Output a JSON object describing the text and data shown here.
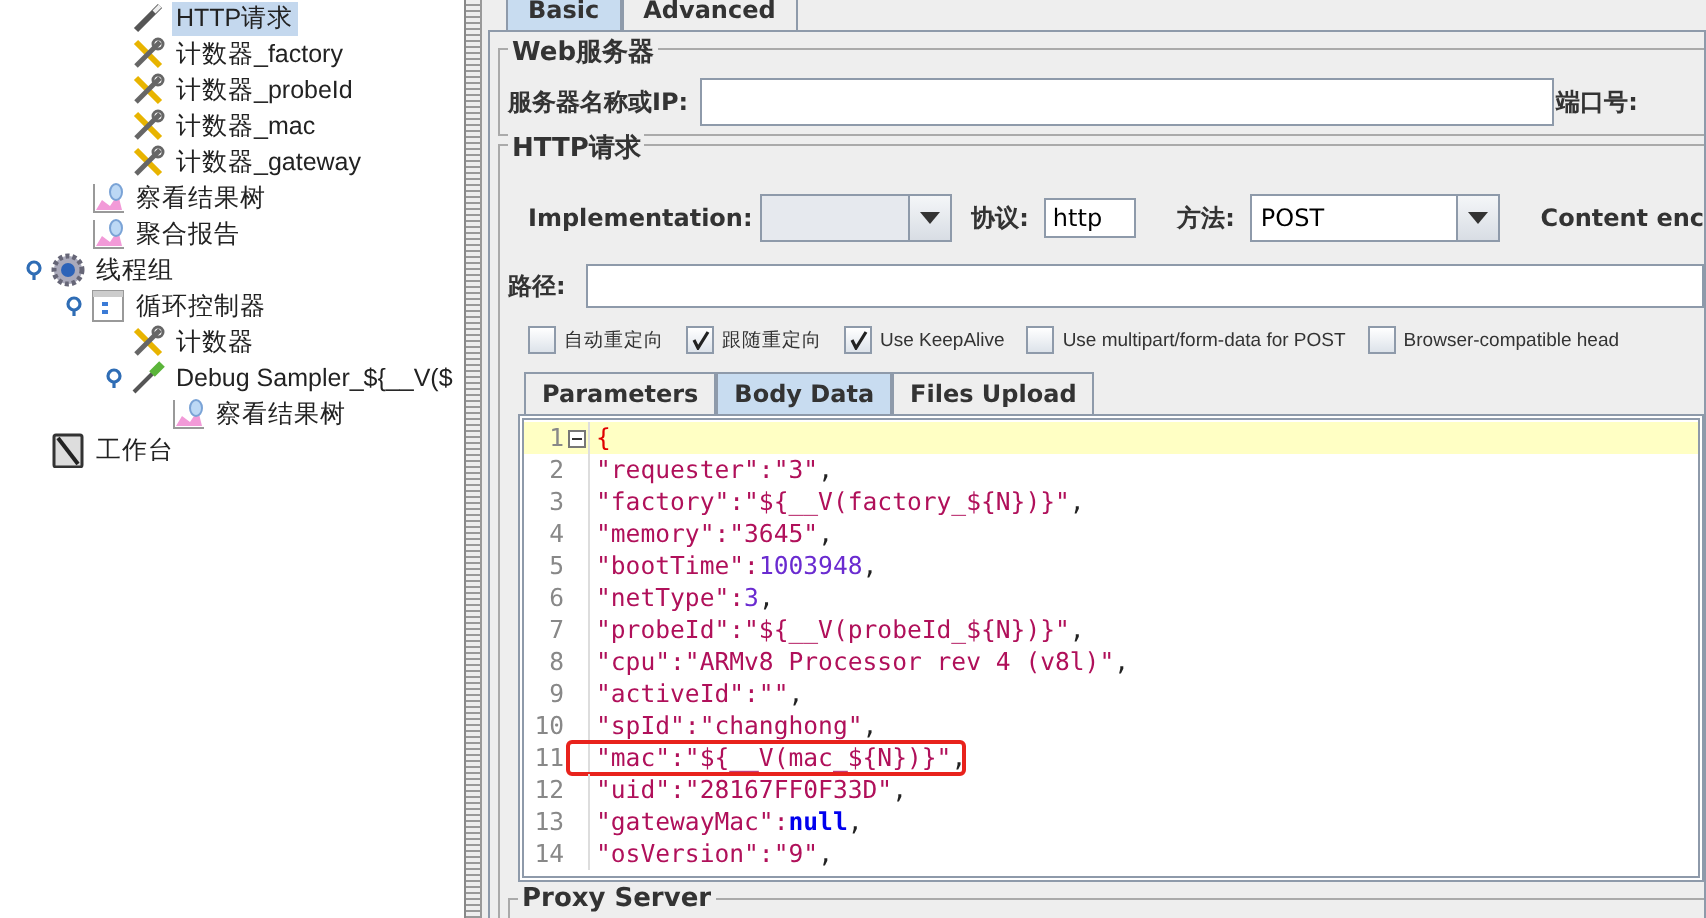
{
  "tree": [
    {
      "children": [
        {
          "children": [
            {
              "label": "HTTP请求",
              "kind": "request",
              "selected": true
            },
            {
              "label": "计数器_factory",
              "kind": "counter",
              "selected": false
            },
            {
              "label": "计数器_probeId",
              "kind": "counter",
              "selected": false
            },
            {
              "label": "计数器_mac",
              "kind": "counter",
              "selected": false
            },
            {
              "label": "计数器_gateway",
              "kind": "counter",
              "selected": false
            }
          ]
        },
        {
          "label": "察看结果树",
          "kind": "listener",
          "selected": false
        },
        {
          "label": "聚合报告",
          "kind": "listener",
          "selected": false
        }
      ]
    },
    {
      "label": "线程组",
      "kind": "thread-group",
      "selected": false,
      "children": [
        {
          "label": "循环控制器",
          "kind": "controller",
          "selected": false,
          "children": [
            {
              "label": "计数器",
              "kind": "counter",
              "selected": false
            },
            {
              "label": "Debug Sampler_${__V($",
              "kind": "sampler",
              "selected": false,
              "children": [
                {
                  "label": "察看结果树",
                  "kind": "listener",
                  "selected": false
                }
              ]
            }
          ]
        }
      ]
    },
    {
      "label": "工作台",
      "kind": "workbench",
      "selected": false
    }
  ],
  "top_tabs": [
    {
      "label": "Basic",
      "selected": true
    },
    {
      "label": "Advanced",
      "selected": false
    }
  ],
  "web_server": {
    "title": "Web服务器",
    "server_label": "服务器名称或IP:",
    "port_label": "端口号:"
  },
  "http_request": {
    "title": "HTTP请求",
    "implementation_label": "Implementation:",
    "protocol_label": "协议:",
    "protocol_value": "http",
    "method_label": "方法:",
    "method_value": "POST",
    "content_encoding_label": "Content enc",
    "path_label": "路径:",
    "options": [
      {
        "label": "自动重定向",
        "checked": false
      },
      {
        "label": "跟随重定向",
        "checked": true
      },
      {
        "label": "Use KeepAlive",
        "checked": true
      },
      {
        "label": "Use multipart/form-data for POST",
        "checked": false
      },
      {
        "label": "Browser-compatible head",
        "checked": false
      }
    ]
  },
  "sub_tabs": [
    {
      "label": "Parameters",
      "selected": false
    },
    {
      "label": "Body Data",
      "selected": true
    },
    {
      "label": "Files Upload",
      "selected": false
    }
  ],
  "body_lines": [
    {
      "number": "1",
      "highlighted": false,
      "tokens": [
        {
          "text": "{",
          "kind": "punct"
        }
      ]
    },
    {
      "number": "2",
      "highlighted": false,
      "tokens": [
        {
          "text": "\"requester\":\"3\"",
          "kind": "string"
        },
        {
          "text": ",",
          "kind": "plain"
        }
      ]
    },
    {
      "number": "3",
      "highlighted": false,
      "tokens": [
        {
          "text": "\"factory\":\"${__V(factory_${N})}\"",
          "kind": "string"
        },
        {
          "text": ",",
          "kind": "plain"
        }
      ]
    },
    {
      "number": "4",
      "highlighted": false,
      "tokens": [
        {
          "text": "\"memory\":\"3645\"",
          "kind": "string"
        },
        {
          "text": ",",
          "kind": "plain"
        }
      ]
    },
    {
      "number": "5",
      "highlighted": false,
      "tokens": [
        {
          "text": "\"bootTime\":",
          "kind": "string"
        },
        {
          "text": "1003948",
          "kind": "number"
        },
        {
          "text": ",",
          "kind": "plain"
        }
      ]
    },
    {
      "number": "6",
      "highlighted": false,
      "tokens": [
        {
          "text": "\"netType\":",
          "kind": "string"
        },
        {
          "text": "3",
          "kind": "number"
        },
        {
          "text": ",",
          "kind": "plain"
        }
      ]
    },
    {
      "number": "7",
      "highlighted": false,
      "tokens": [
        {
          "text": "\"probeId\":\"${__V(probeId_${N})}\"",
          "kind": "string"
        },
        {
          "text": ",",
          "kind": "plain"
        }
      ]
    },
    {
      "number": "8",
      "highlighted": false,
      "tokens": [
        {
          "text": "\"cpu\":\"ARMv8 Processor rev 4 (v8l)\"",
          "kind": "string"
        },
        {
          "text": ",",
          "kind": "plain"
        }
      ]
    },
    {
      "number": "9",
      "highlighted": false,
      "tokens": [
        {
          "text": "\"activeId\":\"\"",
          "kind": "string"
        },
        {
          "text": ",",
          "kind": "plain"
        }
      ]
    },
    {
      "number": "10",
      "highlighted": false,
      "tokens": [
        {
          "text": "\"spId\":\"changhong\"",
          "kind": "string"
        },
        {
          "text": ",",
          "kind": "plain"
        }
      ]
    },
    {
      "number": "11",
      "highlighted": true,
      "tokens": [
        {
          "text": "\"mac\":\"${__V(mac_${N})}\"",
          "kind": "string"
        },
        {
          "text": ",",
          "kind": "plain"
        }
      ]
    },
    {
      "number": "12",
      "highlighted": false,
      "tokens": [
        {
          "text": "\"uid\":\"28167FF0F33D\"",
          "kind": "string"
        },
        {
          "text": ",",
          "kind": "plain"
        }
      ]
    },
    {
      "number": "13",
      "highlighted": false,
      "tokens": [
        {
          "text": "\"gatewayMac\":",
          "kind": "string"
        },
        {
          "text": "null",
          "kind": "keyword"
        },
        {
          "text": ",",
          "kind": "plain"
        }
      ]
    },
    {
      "number": "14",
      "highlighted": false,
      "tokens": [
        {
          "text": "\"osVersion\":\"9\"",
          "kind": "string"
        },
        {
          "text": ",",
          "kind": "plain"
        }
      ]
    }
  ],
  "proxy_server": {
    "title": "Proxy Server"
  }
}
